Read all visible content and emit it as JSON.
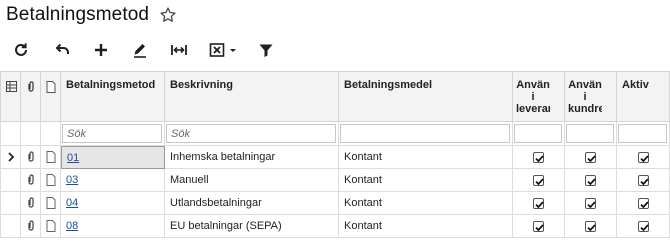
{
  "page": {
    "title": "Betalningsmetod",
    "favorite_icon": "star-outline-icon"
  },
  "toolbar": {
    "buttons": [
      {
        "name": "refresh",
        "icon": "refresh-icon"
      },
      {
        "name": "undo",
        "icon": "undo-icon"
      },
      {
        "name": "add",
        "icon": "plus-icon"
      },
      {
        "name": "edit",
        "icon": "pencil-icon"
      },
      {
        "name": "fit-columns",
        "icon": "fit-width-icon"
      },
      {
        "name": "export-excel",
        "icon": "excel-dropdown-icon"
      },
      {
        "name": "filter",
        "icon": "filter-icon"
      }
    ]
  },
  "table": {
    "columns": {
      "code": "Betalningsmetod",
      "description": "Beskrivning",
      "means": "Betalningsmedel",
      "use_supplier": "Använ i leverar",
      "use_customer": "Använ i kundre",
      "active": "Aktiv"
    },
    "filter_placeholder": "Sök",
    "rows": [
      {
        "code": "01",
        "description": "Inhemska betalningar",
        "means": "Kontant",
        "use_supplier": true,
        "use_customer": true,
        "active": true,
        "current": true
      },
      {
        "code": "03",
        "description": "Manuell",
        "means": "Kontant",
        "use_supplier": true,
        "use_customer": true,
        "active": true,
        "current": false
      },
      {
        "code": "04",
        "description": "Utlandsbetalningar",
        "means": "Kontant",
        "use_supplier": true,
        "use_customer": true,
        "active": true,
        "current": false
      },
      {
        "code": "08",
        "description": "EU betalningar (SEPA)",
        "means": "Kontant",
        "use_supplier": true,
        "use_customer": true,
        "active": true,
        "current": false
      }
    ]
  },
  "colors": {
    "link": "#1a4fa0",
    "header_bg": "#f3f3f3",
    "grid_line": "#dcdcdc"
  }
}
